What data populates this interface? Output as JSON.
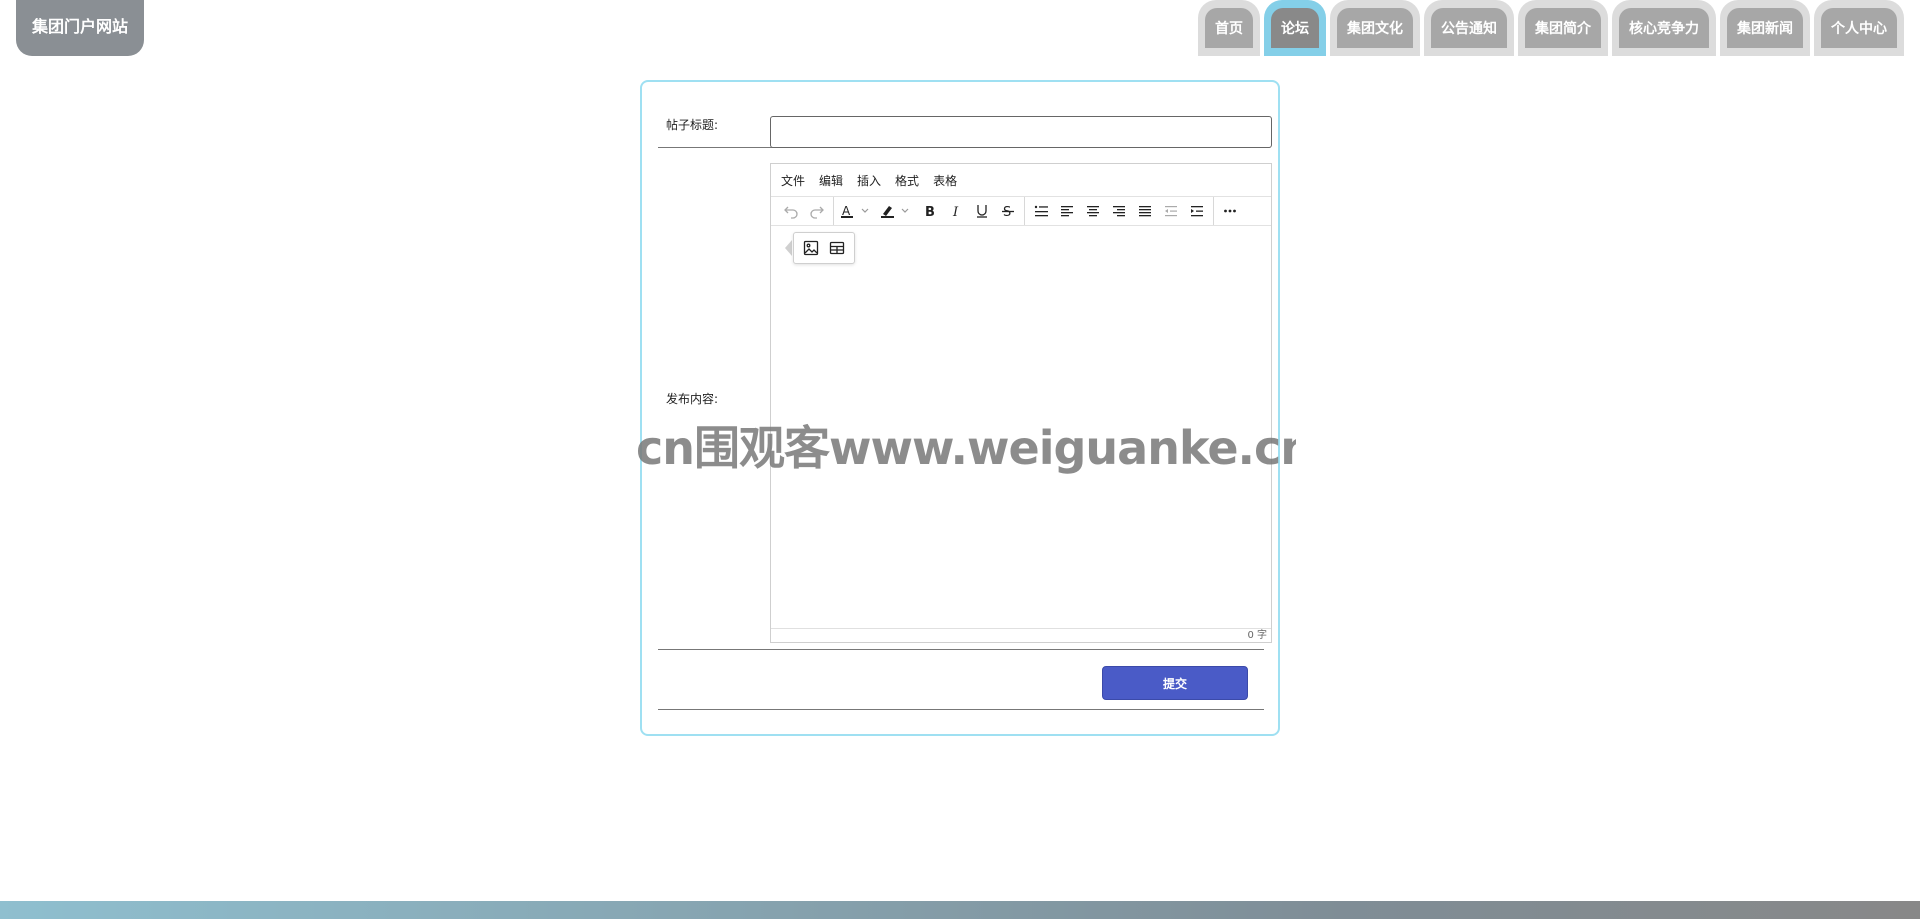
{
  "header": {
    "logo": "集团门户网站",
    "nav": [
      {
        "label": "首页",
        "active": false
      },
      {
        "label": "论坛",
        "active": true
      },
      {
        "label": "集团文化",
        "active": false
      },
      {
        "label": "公告通知",
        "active": false
      },
      {
        "label": "集团简介",
        "active": false
      },
      {
        "label": "核心竞争力",
        "active": false
      },
      {
        "label": "集团新闻",
        "active": false
      },
      {
        "label": "个人中心",
        "active": false
      }
    ]
  },
  "form": {
    "title_label": "帖子标题:",
    "title_value": "",
    "title_placeholder": "",
    "content_label": "发布内容:",
    "editor": {
      "menus": [
        "文件",
        "编辑",
        "插入",
        "格式",
        "表格"
      ],
      "toolbar_icons": [
        "undo-icon",
        "redo-icon",
        "text-color-icon",
        "highlight-icon",
        "bold-icon",
        "italic-icon",
        "underline-icon",
        "strikethrough-icon",
        "bullet-list-icon",
        "align-left-icon",
        "align-center-icon",
        "align-right-icon",
        "align-justify-icon",
        "outdent-icon",
        "indent-icon",
        "more-icon"
      ],
      "quick_insert_icons": [
        "image-icon",
        "table-icon"
      ],
      "word_count": "0 字"
    },
    "submit_label": "提交"
  },
  "watermark": "cn围观客www.weiguanke.cn",
  "colors": {
    "accent": "#4a5bc7",
    "card_border": "#9fe0f2",
    "nav_active": "#84cfe8",
    "logo_bg": "#8a8f94"
  }
}
